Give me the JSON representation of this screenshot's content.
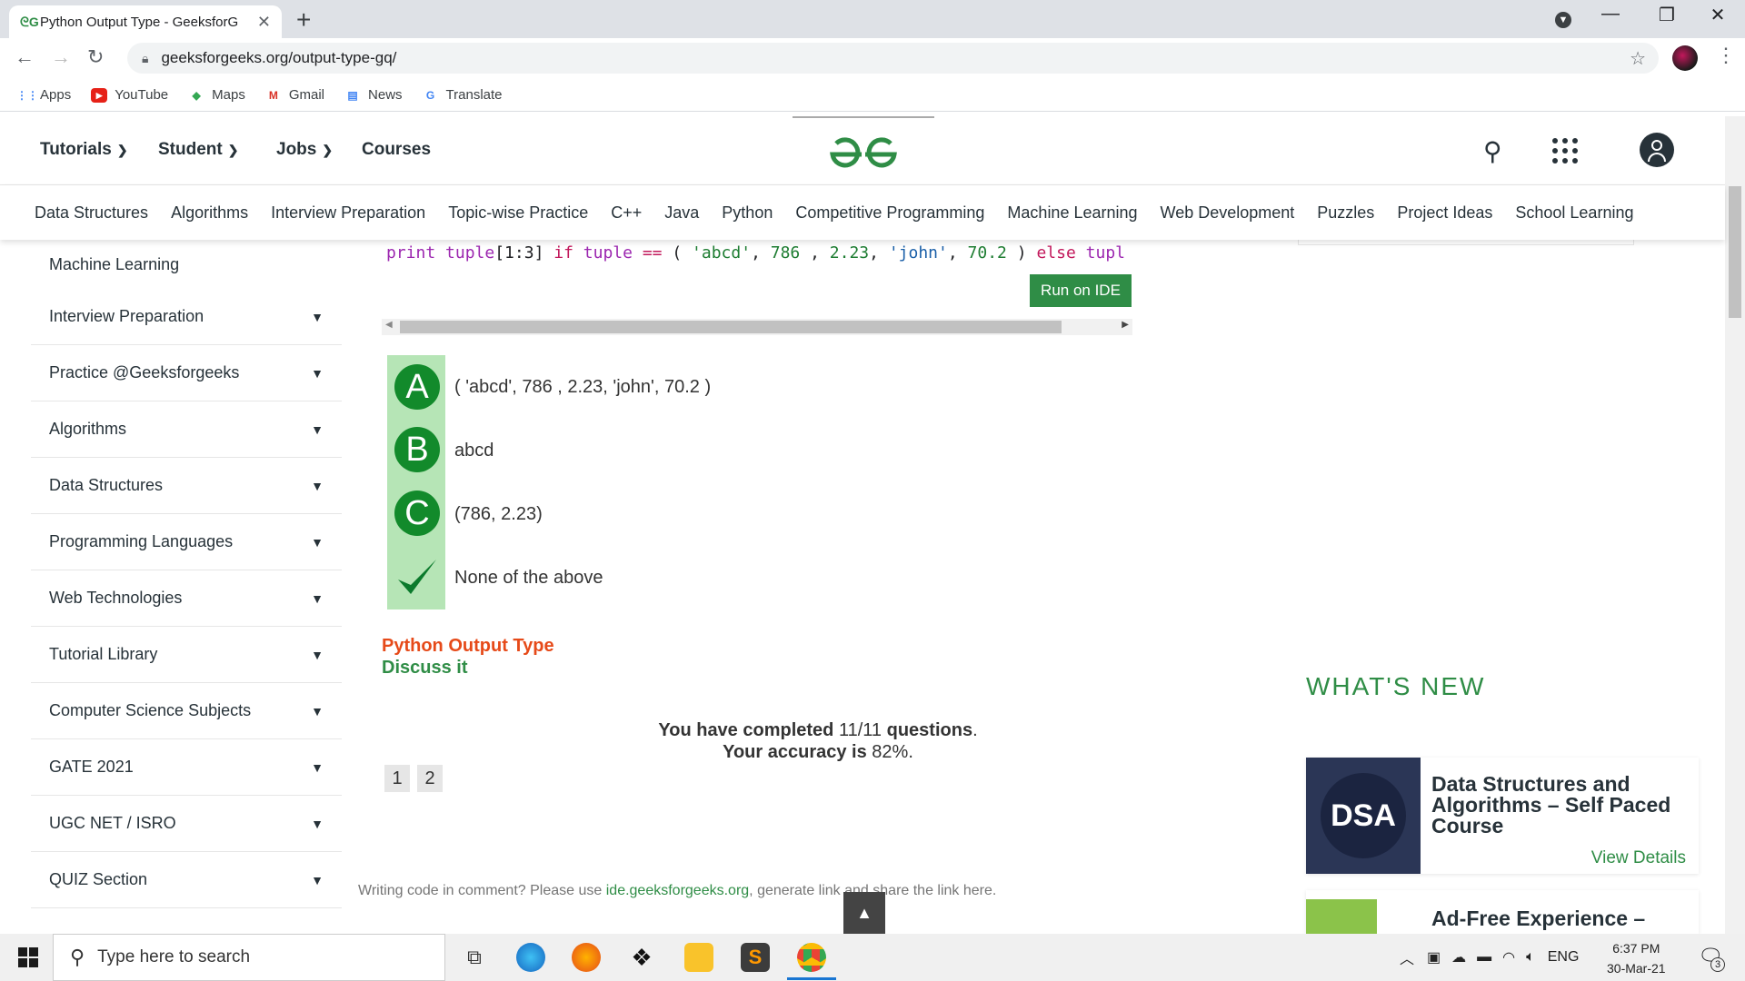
{
  "browser": {
    "tab_title": "Python Output Type - GeeksforG",
    "url": "geeksforgeeks.org/output-type-gq/",
    "bookmarks": [
      "Apps",
      "YouTube",
      "Maps",
      "Gmail",
      "News",
      "Translate"
    ]
  },
  "header": {
    "nav": [
      "Tutorials",
      "Student",
      "Jobs",
      "Courses"
    ],
    "brand_color": "#2f8d46"
  },
  "subnav": [
    "Data Structures",
    "Algorithms",
    "Interview Preparation",
    "Topic-wise Practice",
    "C++",
    "Java",
    "Python",
    "Competitive Programming",
    "Machine Learning",
    "Web Development",
    "Puzzles",
    "Project Ideas",
    "School Learning"
  ],
  "sidebar": {
    "items": [
      {
        "label": "Machine Learning"
      },
      {
        "label": "Interview Preparation"
      },
      {
        "label": "Practice @Geeksforgeeks"
      },
      {
        "label": "Algorithms"
      },
      {
        "label": "Data Structures"
      },
      {
        "label": "Programming Languages"
      },
      {
        "label": "Web Technologies"
      },
      {
        "label": "Tutorial Library"
      },
      {
        "label": "Computer Science Subjects"
      },
      {
        "label": "GATE 2021"
      },
      {
        "label": "UGC NET / ISRO"
      },
      {
        "label": "QUIZ Section"
      }
    ]
  },
  "main": {
    "code": {
      "print": "print",
      "tuple1": "tuple",
      "slice": "[1:3]",
      "if": "if",
      "tuple2": "tuple",
      "eq": "==",
      "open": "(",
      "s1": "'abcd'",
      "n1": "786",
      "n2": "2.23",
      "s2": "'john'",
      "n3": "70.2",
      "close": ")",
      "else": "else",
      "tail": "tupl"
    },
    "run_label": "Run on IDE",
    "options": [
      {
        "marker": "A",
        "text": "( 'abcd', 786 , 2.23, 'john', 70.2 )"
      },
      {
        "marker": "B",
        "text": "abcd"
      },
      {
        "marker": "C",
        "text": "(786, 2.23)"
      },
      {
        "marker": "check-icon",
        "text": "None of the above"
      }
    ],
    "quiz_type": "Python Output Type",
    "discuss": "Discuss it",
    "completed_pre": "You have completed",
    "completed_val": "11/11",
    "completed_post": "questions",
    "accuracy_pre": "Your accuracy is",
    "accuracy_val": "82%",
    "pages": [
      "1",
      "2"
    ],
    "comment_pre": "Writing code in comment? Please use",
    "comment_link": "ide.geeksforgeeks.org",
    "comment_post": ", generate link and share the link here."
  },
  "right": {
    "whats_new": "WHAT'S NEW",
    "card1_logo": "DSA",
    "card1_title_lines": [
      "Data Structures and",
      "Algorithms – Self Paced",
      "Course"
    ],
    "card1_link": "View Details",
    "card2_title": "Ad-Free Experience –"
  },
  "taskbar": {
    "search_placeholder": "Type here to search",
    "lang": "ENG",
    "time": "6:37 PM",
    "date": "30-Mar-21",
    "notif_count": "3"
  }
}
